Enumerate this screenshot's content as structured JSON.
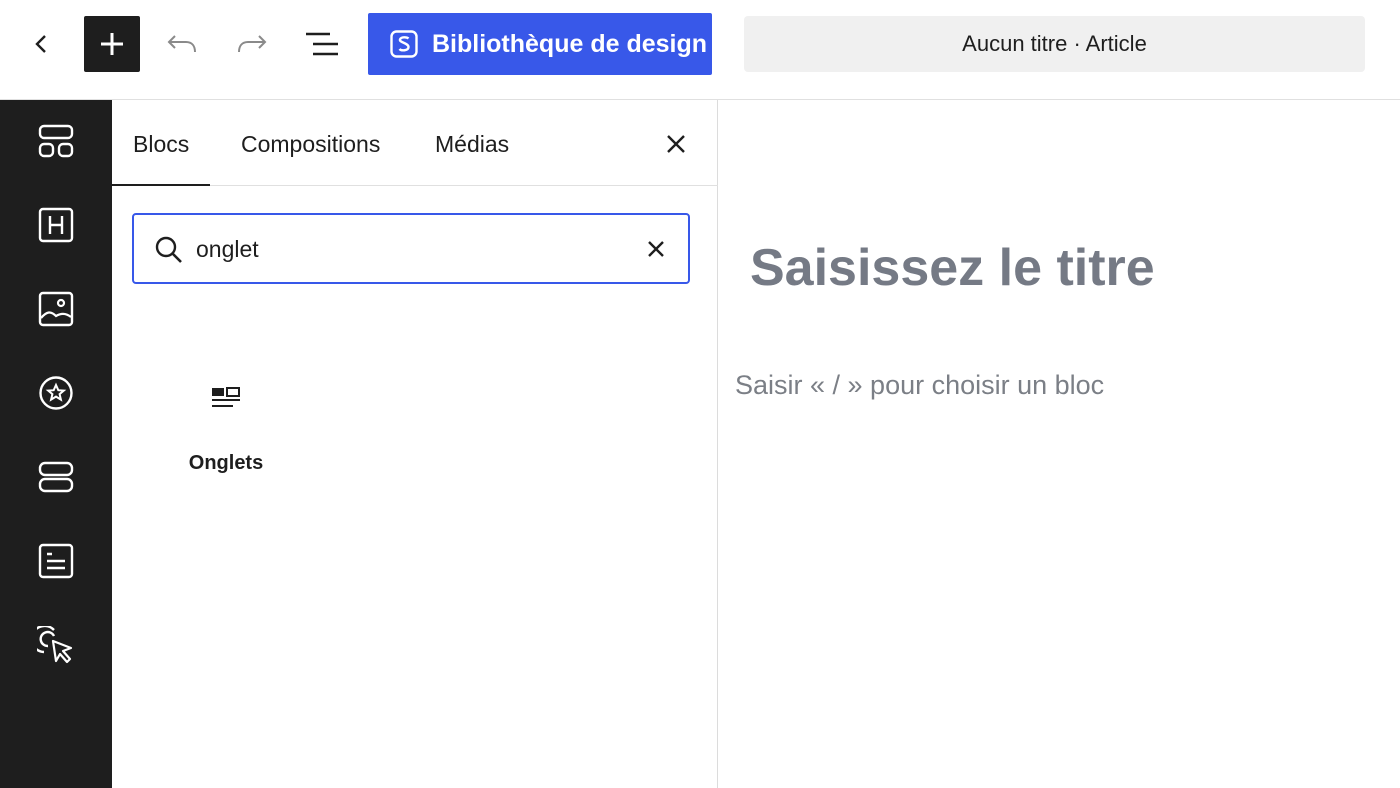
{
  "topbar": {
    "back_icon": "chevron-left-icon",
    "add_icon": "plus-icon",
    "undo_icon": "undo-icon",
    "redo_icon": "redo-icon",
    "outline_icon": "list-view-icon",
    "design_library": {
      "label": "Bibliothèque de design",
      "icon": "s-logo-icon",
      "color": "#3858e9"
    },
    "document_title": "Aucun titre · Article"
  },
  "rail": {
    "items": [
      {
        "icon": "blocks-grid-icon"
      },
      {
        "icon": "heading-icon"
      },
      {
        "icon": "image-icon"
      },
      {
        "icon": "star-circle-icon"
      },
      {
        "icon": "stack-icon"
      },
      {
        "icon": "text-card-icon"
      },
      {
        "icon": "pointer-click-icon"
      }
    ],
    "background": "#1e1e1e"
  },
  "inserter": {
    "tabs": [
      {
        "label": "Blocs",
        "active": true
      },
      {
        "label": "Compositions",
        "active": false
      },
      {
        "label": "Médias",
        "active": false
      }
    ],
    "close_icon": "close-icon",
    "search": {
      "value": "onglet",
      "icon": "search-icon",
      "clear_icon": "close-icon"
    },
    "results": [
      {
        "label": "Onglets",
        "icon": "tabs-block-icon"
      }
    ]
  },
  "canvas": {
    "title_placeholder": "Saisissez le titre",
    "block_placeholder": "Saisir « / » pour choisir un bloc"
  }
}
